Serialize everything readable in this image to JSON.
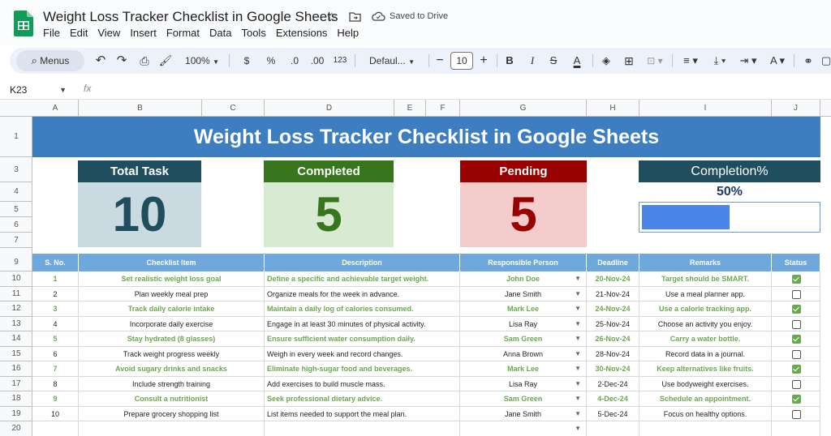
{
  "app": {
    "title": "Weight Loss Tracker Checklist in Google Sheets",
    "saved_status": "Saved to Drive",
    "menu": [
      "File",
      "Edit",
      "View",
      "Insert",
      "Format",
      "Data",
      "Tools",
      "Extensions",
      "Help"
    ],
    "icons": [
      "star-icon",
      "move-folder-icon",
      "cloud-saved-icon"
    ]
  },
  "toolbar": {
    "menus_label": "Menus",
    "zoom": "100%",
    "currency": "$",
    "percent": "%",
    "decrease_decimal": ".0",
    "increase_decimal": ".00",
    "number_format": "123",
    "font": "Defaul...",
    "font_size": "10"
  },
  "formula_bar": {
    "cell_ref": "K23",
    "fx": "fx"
  },
  "columns": [
    "A",
    "B",
    "C",
    "D",
    "E",
    "F",
    "G",
    "H",
    "I",
    "J"
  ],
  "rows": [
    "1",
    "3",
    "4",
    "5",
    "6",
    "7",
    "9",
    "10",
    "11",
    "12",
    "13",
    "14",
    "15",
    "16",
    "17",
    "18",
    "19",
    "20"
  ],
  "sheet": {
    "banner": "Weight Loss Tracker Checklist in Google Sheets",
    "kpis": {
      "total": {
        "label": "Total Task",
        "value": "10"
      },
      "completed": {
        "label": "Completed",
        "value": "5"
      },
      "pending": {
        "label": "Pending",
        "value": "5"
      },
      "completion": {
        "label": "Completion%",
        "value": "50%",
        "fraction": 0.5
      }
    },
    "headers": [
      "S. No.",
      "Checklist Item",
      "Description",
      "Responsible Person",
      "Deadline",
      "Remarks",
      "Status"
    ],
    "tasks": [
      {
        "no": "1",
        "item": "Set realistic weight loss goal",
        "desc": "Define a specific and achievable target weight.",
        "person": "John Doe",
        "deadline": "20-Nov-24",
        "remarks": "Target should be SMART.",
        "done": true
      },
      {
        "no": "2",
        "item": "Plan weekly meal prep",
        "desc": "Organize meals for the week in advance.",
        "person": "Jane Smith",
        "deadline": "21-Nov-24",
        "remarks": "Use a meal planner app.",
        "done": false
      },
      {
        "no": "3",
        "item": "Track daily calorie intake",
        "desc": "Maintain a daily log of calories consumed.",
        "person": "Mark Lee",
        "deadline": "24-Nov-24",
        "remarks": "Use a calorie tracking app.",
        "done": true
      },
      {
        "no": "4",
        "item": "Incorporate daily exercise",
        "desc": "Engage in at least 30 minutes of physical activity.",
        "person": "Lisa Ray",
        "deadline": "25-Nov-24",
        "remarks": "Choose an activity you enjoy.",
        "done": false
      },
      {
        "no": "5",
        "item": "Stay hydrated (8 glasses)",
        "desc": "Ensure sufficient water consumption daily.",
        "person": "Sam Green",
        "deadline": "26-Nov-24",
        "remarks": "Carry a water bottle.",
        "done": true
      },
      {
        "no": "6",
        "item": "Track weight progress weekly",
        "desc": "Weigh in every week and record changes.",
        "person": "Anna Brown",
        "deadline": "28-Nov-24",
        "remarks": "Record data in a journal.",
        "done": false
      },
      {
        "no": "7",
        "item": "Avoid sugary drinks and snacks",
        "desc": "Eliminate high-sugar food and beverages.",
        "person": "Mark Lee",
        "deadline": "30-Nov-24",
        "remarks": "Keep alternatives like fruits.",
        "done": true
      },
      {
        "no": "8",
        "item": "Include strength training",
        "desc": "Add exercises to build muscle mass.",
        "person": "Lisa Ray",
        "deadline": "2-Dec-24",
        "remarks": "Use bodyweight exercises.",
        "done": false
      },
      {
        "no": "9",
        "item": "Consult a nutritionist",
        "desc": "Seek professional dietary advice.",
        "person": "Sam Green",
        "deadline": "4-Dec-24",
        "remarks": "Schedule an appointment.",
        "done": true
      },
      {
        "no": "10",
        "item": "Prepare grocery shopping list",
        "desc": "List items needed to support the meal plan.",
        "person": "Jane Smith",
        "deadline": "5-Dec-24",
        "remarks": "Focus on healthy options.",
        "done": false
      }
    ]
  }
}
